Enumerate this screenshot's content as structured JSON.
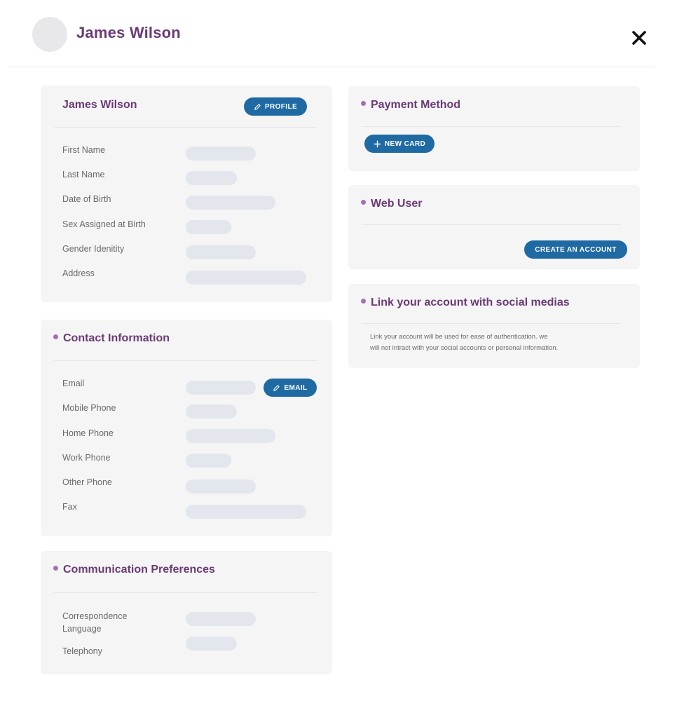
{
  "header": {
    "title": "James Wilson"
  },
  "profile_card": {
    "title": "James Wilson",
    "button_label": "PROFILE",
    "fields": [
      "First Name",
      "Last Name",
      "Date of Birth",
      "Sex Assigned at Birth",
      "Gender Idenitity",
      "Address"
    ]
  },
  "contact_card": {
    "title": "Contact Information",
    "button_label": "EMAIL",
    "fields": [
      "Email",
      "Mobile Phone",
      "Home Phone",
      "Work Phone",
      "Other Phone",
      "Fax"
    ]
  },
  "communication_card": {
    "title": "Communication Preferences",
    "fields": [
      "Correspondence Language",
      "Telephony"
    ]
  },
  "payment_card": {
    "title": "Payment Method",
    "button_label": "NEW CARD"
  },
  "web_user_card": {
    "title": "Web User",
    "button_label": "CREATE AN ACCOUNT"
  },
  "social_card": {
    "title": "Link your account with social medias",
    "description_line1": "Link your account will be used for ease of authentication. we",
    "description_line2": "will not intract with your social accounts or personal information."
  },
  "colors": {
    "accent_purple": "#6b3b74",
    "dot_purple": "#a66fb3",
    "button_blue": "#1f6aa3",
    "card_bg": "#f5f5f6",
    "skeleton": "#e4e6ee"
  },
  "icons": {
    "close": "close-icon",
    "edit": "pencil-icon",
    "add": "plus-icon"
  }
}
